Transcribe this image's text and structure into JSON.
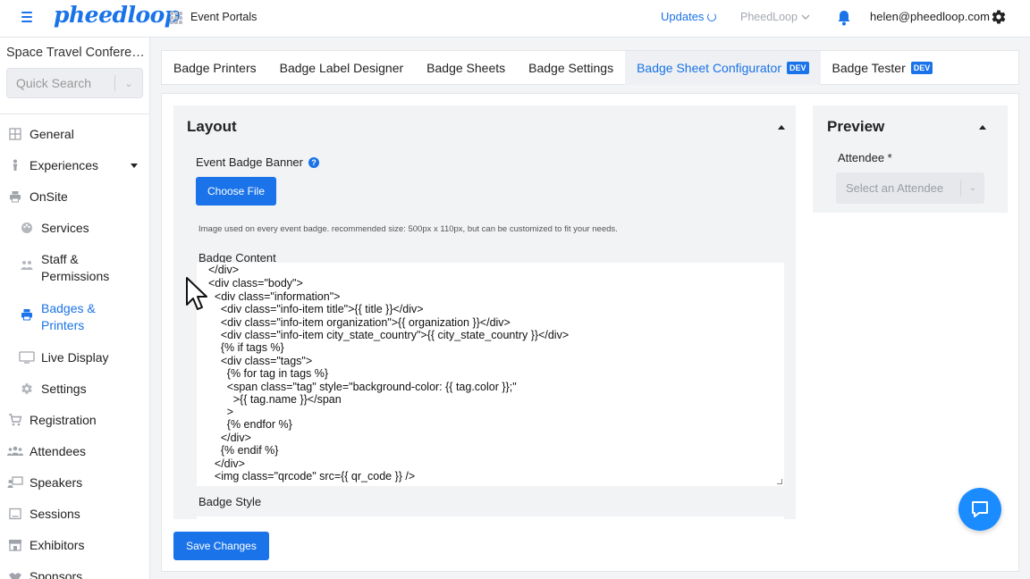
{
  "topbar": {
    "logo": "pheedloop",
    "portal_label": "Event Portals",
    "updates_label": "Updates",
    "org_dropdown": "PheedLoop",
    "user_email": "helen@pheedloop.com"
  },
  "sidebar": {
    "event_name": "Space Travel Conference",
    "search_placeholder": "Quick Search",
    "items": [
      {
        "label": "General",
        "icon": "grid-icon"
      },
      {
        "label": "Experiences",
        "icon": "person-icon"
      },
      {
        "label": "OnSite",
        "icon": "printer-icon"
      },
      {
        "label": "Services",
        "icon": "palette-icon"
      },
      {
        "label": "Staff &\nPermissions",
        "icon": "people-icon"
      },
      {
        "label": "Badges &\nPrinters",
        "icon": "printer-icon",
        "active": true
      },
      {
        "label": "Live Display",
        "icon": "monitor-icon"
      },
      {
        "label": "Settings",
        "icon": "gear-icon"
      },
      {
        "label": "Registration",
        "icon": "cart-icon"
      },
      {
        "label": "Attendees",
        "icon": "group-icon"
      },
      {
        "label": "Speakers",
        "icon": "presenter-icon"
      },
      {
        "label": "Sessions",
        "icon": "screen-icon"
      },
      {
        "label": "Exhibitors",
        "icon": "store-icon"
      },
      {
        "label": "Sponsors",
        "icon": "handshake-icon"
      }
    ]
  },
  "tabs": [
    {
      "label": "Badge Printers"
    },
    {
      "label": "Badge Label Designer"
    },
    {
      "label": "Badge Sheets"
    },
    {
      "label": "Badge Settings"
    },
    {
      "label": "Badge Sheet Configurator",
      "badge": "DEV",
      "active": true
    },
    {
      "label": "Badge Tester",
      "badge": "DEV"
    }
  ],
  "layout": {
    "title": "Layout",
    "banner_label": "Event Badge Banner",
    "choose_file": "Choose File",
    "hint": "Image used on every event badge. recommended size: 500px x 110px, but can be customized to fit your needs.",
    "content_label": "Badge Content",
    "code_lines": [
      "  </div>",
      "  <div class=\"body\">",
      "    <div class=\"information\">",
      "      <div class=\"info-item title\">{{ title }}</div>",
      "      <div class=\"info-item organization\">{{ organization }}</div>",
      "      <div class=\"info-item city_state_country\">{{ city_state_country }}</div>",
      "      {% if tags %}",
      "      <div class=\"tags\">",
      "        {% for tag in tags %}",
      "        <span class=\"tag\" style=\"background-color: {{ tag.color }};\"",
      "          >{{ tag.name }}</span",
      "        >",
      "        {% endfor %}",
      "      </div>",
      "      {% endif %}",
      "    </div>",
      "    <img class=\"qrcode\" src={{ qr_code }} />"
    ],
    "style_label": "Badge Style",
    "save_button": "Save Changes"
  },
  "preview": {
    "title": "Preview",
    "attendee_label": "Attendee *",
    "attendee_placeholder": "Select an Attendee"
  },
  "colors": {
    "accent": "#1a73e8",
    "panel": "#f2f3f5"
  }
}
